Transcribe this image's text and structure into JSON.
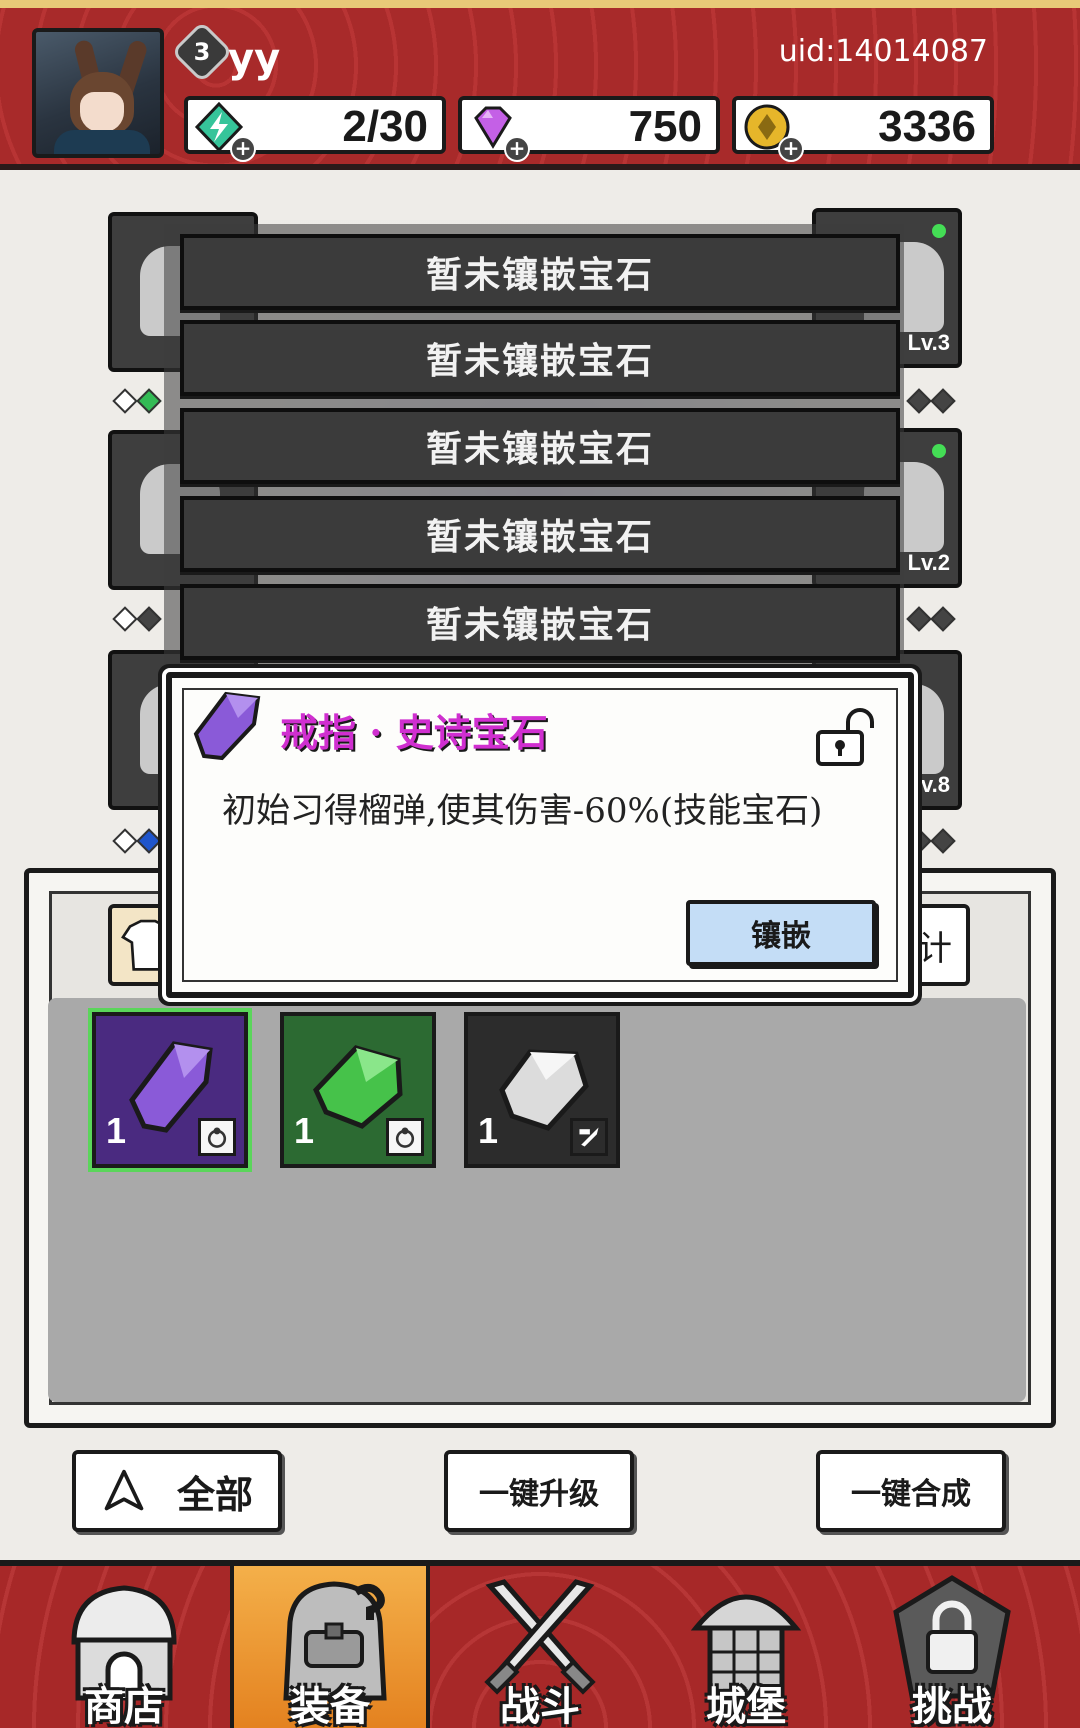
{
  "player": {
    "level": "3",
    "name": "yy",
    "uid": "uid:14014087"
  },
  "resources": {
    "energy": "2/30",
    "gems": "750",
    "coins": "3336"
  },
  "equipment": {
    "slots": [
      {
        "position": "left-1",
        "level": ""
      },
      {
        "position": "right-1",
        "level": "Lv.3"
      },
      {
        "position": "left-2",
        "level": ""
      },
      {
        "position": "right-2",
        "level": "Lv.2"
      },
      {
        "position": "left-3",
        "level": ""
      },
      {
        "position": "right-3",
        "level": "Lv.8"
      }
    ]
  },
  "gem_sockets": [
    "暂未镶嵌宝石",
    "暂未镶嵌宝石",
    "暂未镶嵌宝石",
    "暂未镶嵌宝石",
    "暂未镶嵌宝石"
  ],
  "tooltip": {
    "title": "戒指 · 史诗宝石",
    "description": "初始习得榴弹,使其伤害-60%(技能宝石)",
    "action_label": "镶嵌",
    "title_color": "#d02fd0"
  },
  "inventory": {
    "right_tab_label": "计",
    "items": [
      {
        "rarity": "epic",
        "color": "#7a4fd0",
        "count": "1",
        "type_icon": "ring-icon"
      },
      {
        "rarity": "rare",
        "color": "#43b545",
        "count": "1",
        "type_icon": "ring-icon"
      },
      {
        "rarity": "common",
        "color": "#d8d8d8",
        "count": "1",
        "type_icon": "weapon-icon"
      }
    ]
  },
  "actions": {
    "filter_label": "全部",
    "upgrade_label": "一键升级",
    "merge_label": "一键合成"
  },
  "nav": {
    "shop": "商店",
    "equipment": "装备",
    "battle": "战斗",
    "castle": "城堡",
    "challenge": "挑战",
    "active": "equipment"
  }
}
